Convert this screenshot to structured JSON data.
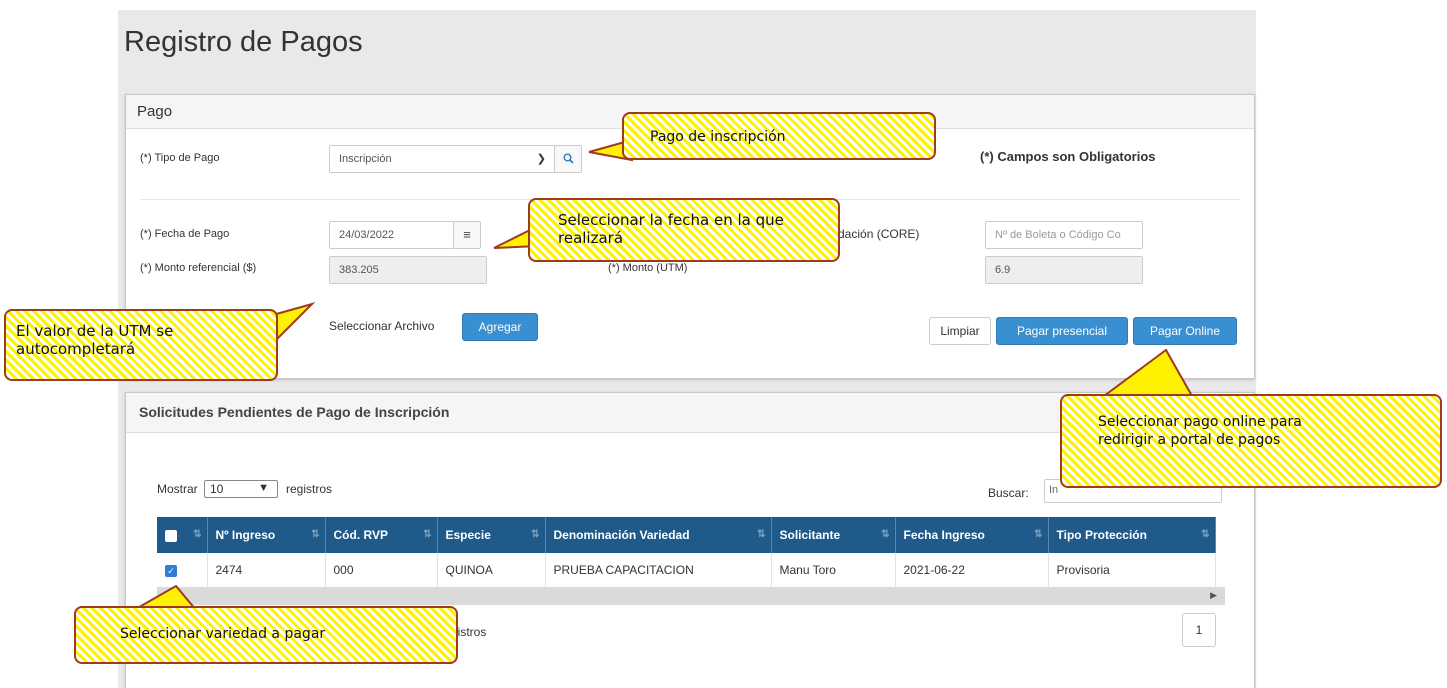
{
  "page": {
    "title": "Registro de Pagos"
  },
  "pago_panel": {
    "heading": "Pago",
    "tipo_pago_label": "(*) Tipo de Pago",
    "tipo_pago_value": "Inscripción",
    "required_note": "(*) Campos son Obligatorios",
    "fecha_label": "(*) Fecha de Pago",
    "fecha_value": "24/03/2022",
    "boleta_label_fragment": "dación (CORE)",
    "boleta_placeholder": "Nº de Boleta o Código Co",
    "monto_ref_label": "(*) Monto referencial ($)",
    "monto_ref_value": "383.205",
    "monto_utm_label": "(*) Monto (UTM)",
    "monto_utm_value": "6.9",
    "archivo_label": "Seleccionar Archivo",
    "agregar_button": "Agregar",
    "limpiar_button": "Limpiar",
    "presencial_button": "Pagar presencial",
    "online_button": "Pagar Online"
  },
  "solicitudes_panel": {
    "heading": "Solicitudes Pendientes de Pago de Inscripción",
    "mostrar_label": "Mostrar",
    "mostrar_value": "10",
    "registros_label": "registros",
    "buscar_label": "Buscar:",
    "buscar_value_fragment": "In",
    "footer_fragment": "gistros",
    "page_number": "1",
    "columns": [
      "Nº Ingreso",
      "Cód. RVP",
      "Especie",
      "Denominación Variedad",
      "Solicitante",
      "Fecha Ingreso",
      "Tipo Protección"
    ],
    "rows": [
      {
        "nro": "2474",
        "cod": "000",
        "especie": "QUINOA",
        "denominacion": "PRUEBA CAPACITACION",
        "solicitante": "Manu Toro",
        "fecha": "2021-06-22",
        "tipo": "Provisoria"
      }
    ]
  },
  "callouts": {
    "pago_inscripcion": "Pago de inscripción",
    "fecha_line1": "Seleccionar la fecha en la que",
    "fecha_line2": "realizará",
    "utm_line1": "El valor de la UTM se",
    "utm_line2": "autocompletará",
    "online_line1": "Seleccionar pago online para",
    "online_line2": "redirigir a portal de pagos",
    "variedad": "Seleccionar variedad a pagar"
  },
  "colors": {
    "primary_button": "#3a8fd1",
    "table_header": "#1f5a8a",
    "callout_fill": "#fff200",
    "callout_border": "#9e3a1d"
  }
}
